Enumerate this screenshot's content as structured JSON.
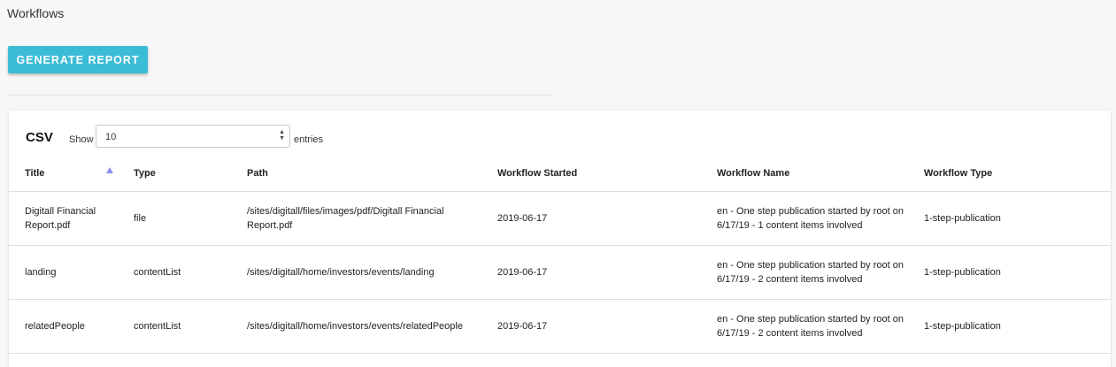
{
  "page": {
    "title": "Workflows"
  },
  "toolbar": {
    "generate_label": "GENERATE REPORT"
  },
  "card": {
    "title": "CSV",
    "show_label": "Show",
    "entries_value": "10",
    "entries_label": "entries"
  },
  "table": {
    "columns": [
      "Title",
      "Type",
      "Path",
      "Workflow Started",
      "Workflow Name",
      "Workflow Type"
    ],
    "rows": [
      {
        "title": "Digitall Financial Report.pdf",
        "type": "file",
        "path": "/sites/digitall/files/images/pdf/Digitall Financial Report.pdf",
        "started": "2019-06-17",
        "name": "en - One step publication started by root on 6/17/19 - 1 content items involved",
        "wtype": "1-step-publication"
      },
      {
        "title": "landing",
        "type": "contentList",
        "path": "/sites/digitall/home/investors/events/landing",
        "started": "2019-06-17",
        "name": "en - One step publication started by root on 6/17/19 - 2 content items involved",
        "wtype": "1-step-publication"
      },
      {
        "title": "relatedPeople",
        "type": "contentList",
        "path": "/sites/digitall/home/investors/events/relatedPeople",
        "started": "2019-06-17",
        "name": "en - One step publication started by root on 6/17/19 - 2 content items involved",
        "wtype": "1-step-publication"
      }
    ]
  },
  "colors": {
    "accent": "#3bbcd6",
    "sort_indicator": "#8a8ff0"
  }
}
